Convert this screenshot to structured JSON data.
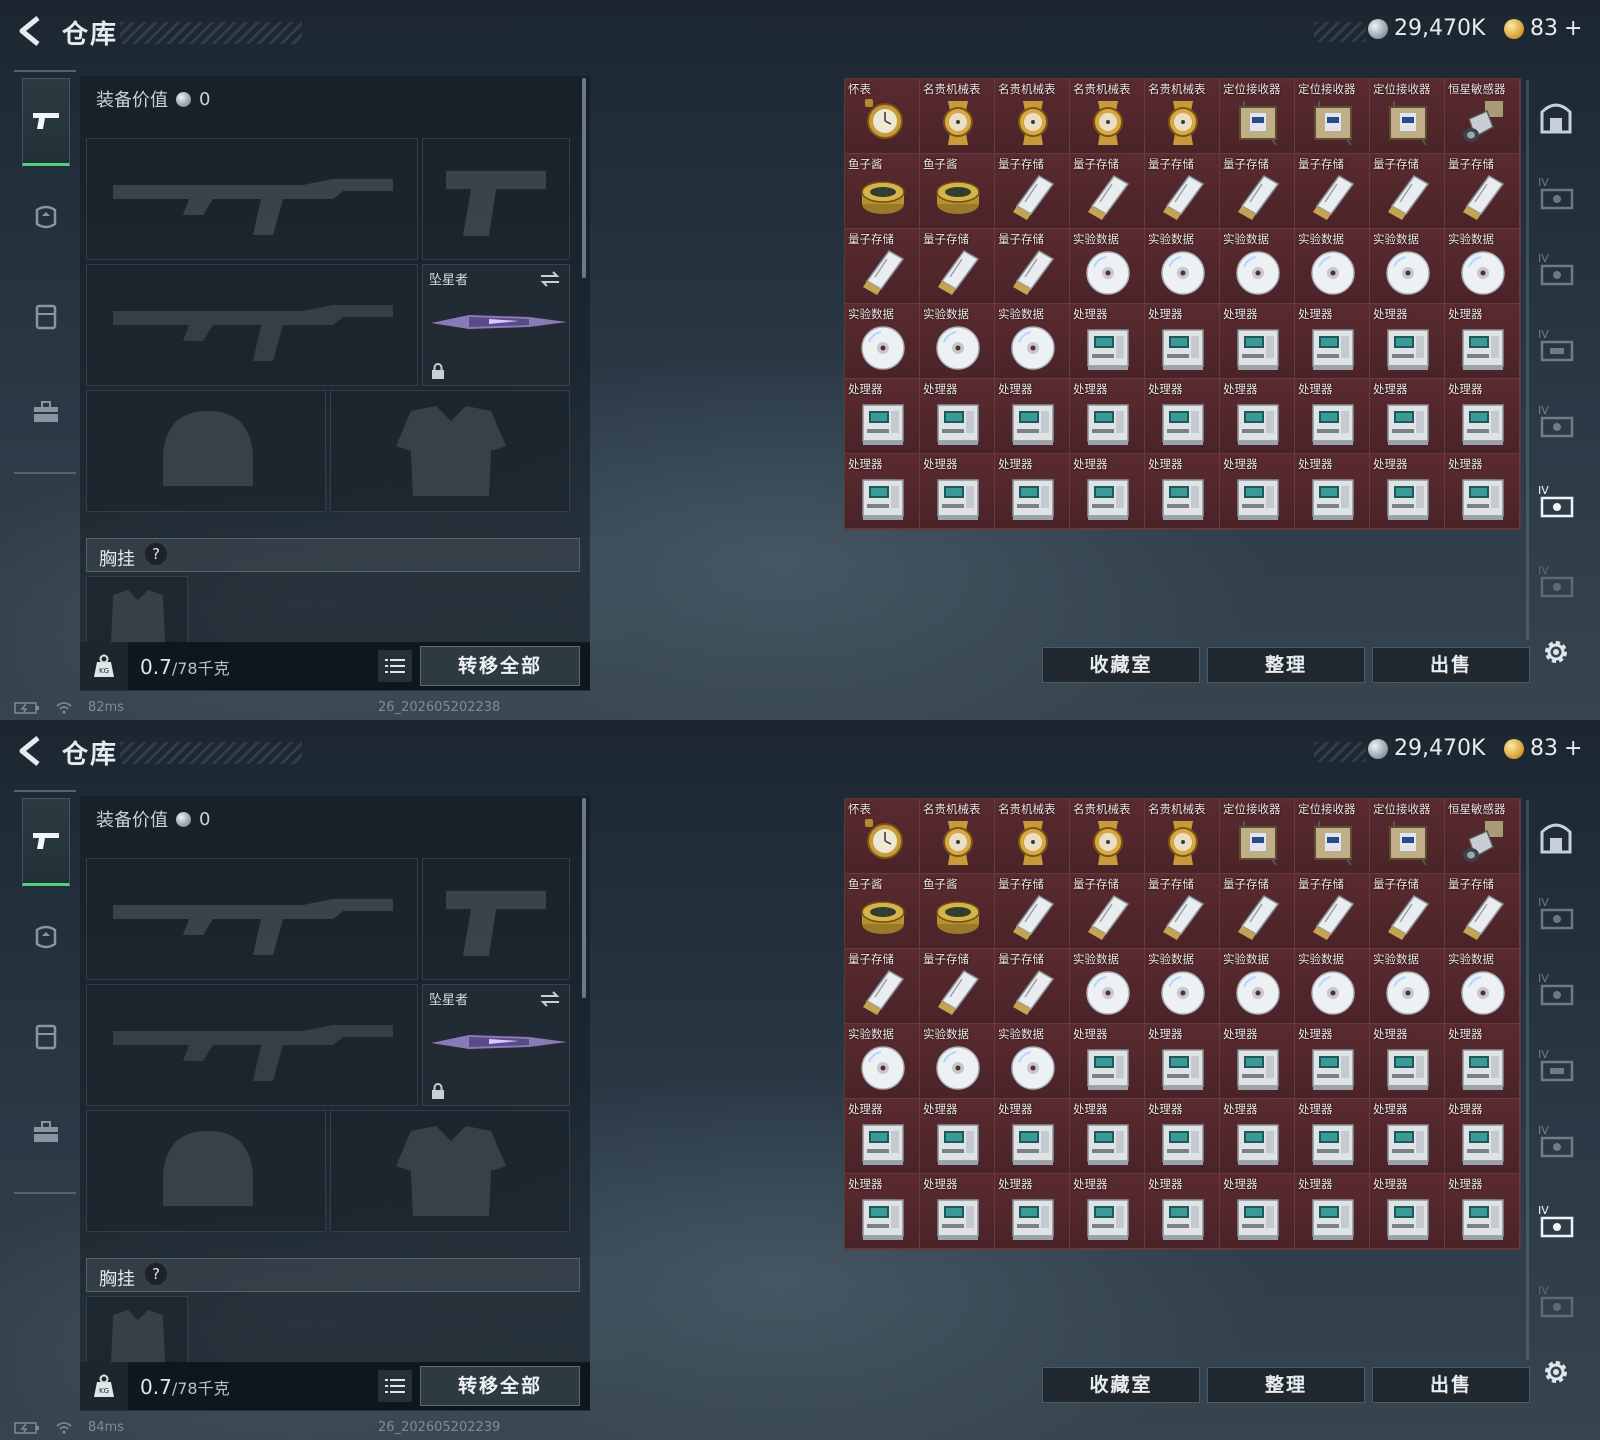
{
  "header": {
    "title": "仓库",
    "currency_silver": "29,470K",
    "currency_gold": "83",
    "gold_plus": "+"
  },
  "equipment": {
    "value_label": "装备价值",
    "value": "0",
    "melee_name": "坠星者",
    "chest_label": "胸挂",
    "help": "?"
  },
  "weight": {
    "current": "0.7",
    "max": "/78千克"
  },
  "buttons": {
    "transfer_all": "转移全部",
    "collection": "收藏室",
    "organize": "整理",
    "sell": "出售"
  },
  "inventory": {
    "rows": [
      [
        {
          "label": "怀表",
          "icon": "pocket-watch"
        },
        {
          "label": "名贵机械表",
          "icon": "luxury-watch"
        },
        {
          "label": "名贵机械表",
          "icon": "luxury-watch"
        },
        {
          "label": "名贵机械表",
          "icon": "luxury-watch"
        },
        {
          "label": "名贵机械表",
          "icon": "luxury-watch"
        },
        {
          "label": "定位接收器",
          "icon": "gps-receiver"
        },
        {
          "label": "定位接收器",
          "icon": "gps-receiver"
        },
        {
          "label": "定位接收器",
          "icon": "gps-receiver"
        },
        {
          "label": "恒星敏感器",
          "icon": "star-sensor"
        }
      ],
      [
        {
          "label": "鱼子酱",
          "icon": "caviar-tin"
        },
        {
          "label": "鱼子酱",
          "icon": "caviar-tin"
        },
        {
          "label": "量子存储",
          "icon": "quantum-storage"
        },
        {
          "label": "量子存储",
          "icon": "quantum-storage"
        },
        {
          "label": "量子存储",
          "icon": "quantum-storage"
        },
        {
          "label": "量子存储",
          "icon": "quantum-storage"
        },
        {
          "label": "量子存储",
          "icon": "quantum-storage"
        },
        {
          "label": "量子存储",
          "icon": "quantum-storage"
        },
        {
          "label": "量子存储",
          "icon": "quantum-storage"
        }
      ],
      [
        {
          "label": "量子存储",
          "icon": "quantum-storage"
        },
        {
          "label": "量子存储",
          "icon": "quantum-storage"
        },
        {
          "label": "量子存储",
          "icon": "quantum-storage"
        },
        {
          "label": "实验数据",
          "icon": "data-disc"
        },
        {
          "label": "实验数据",
          "icon": "data-disc"
        },
        {
          "label": "实验数据",
          "icon": "data-disc"
        },
        {
          "label": "实验数据",
          "icon": "data-disc"
        },
        {
          "label": "实验数据",
          "icon": "data-disc"
        },
        {
          "label": "实验数据",
          "icon": "data-disc"
        }
      ],
      [
        {
          "label": "实验数据",
          "icon": "data-disc"
        },
        {
          "label": "实验数据",
          "icon": "data-disc"
        },
        {
          "label": "实验数据",
          "icon": "data-disc"
        },
        {
          "label": "处理器",
          "icon": "processor"
        },
        {
          "label": "处理器",
          "icon": "processor"
        },
        {
          "label": "处理器",
          "icon": "processor"
        },
        {
          "label": "处理器",
          "icon": "processor"
        },
        {
          "label": "处理器",
          "icon": "processor"
        },
        {
          "label": "处理器",
          "icon": "processor"
        }
      ],
      [
        {
          "label": "处理器",
          "icon": "processor"
        },
        {
          "label": "处理器",
          "icon": "processor"
        },
        {
          "label": "处理器",
          "icon": "processor"
        },
        {
          "label": "处理器",
          "icon": "processor"
        },
        {
          "label": "处理器",
          "icon": "processor"
        },
        {
          "label": "处理器",
          "icon": "processor"
        },
        {
          "label": "处理器",
          "icon": "processor"
        },
        {
          "label": "处理器",
          "icon": "processor"
        },
        {
          "label": "处理器",
          "icon": "processor"
        }
      ],
      [
        {
          "label": "处理器",
          "icon": "processor"
        },
        {
          "label": "处理器",
          "icon": "processor"
        },
        {
          "label": "处理器",
          "icon": "processor"
        },
        {
          "label": "处理器",
          "icon": "processor"
        },
        {
          "label": "处理器",
          "icon": "processor"
        },
        {
          "label": "处理器",
          "icon": "processor"
        },
        {
          "label": "处理器",
          "icon": "processor"
        },
        {
          "label": "处理器",
          "icon": "processor"
        },
        {
          "label": "处理器",
          "icon": "processor"
        }
      ]
    ]
  },
  "status_top": {
    "ping": "82ms",
    "build": "26_202605202238"
  },
  "status_bottom": {
    "ping": "84ms",
    "build": "26_202605202239"
  },
  "colors": {
    "accent_green": "#4fd08a",
    "cell_bg": "#5a2b30",
    "gold": "#d39b2c"
  }
}
